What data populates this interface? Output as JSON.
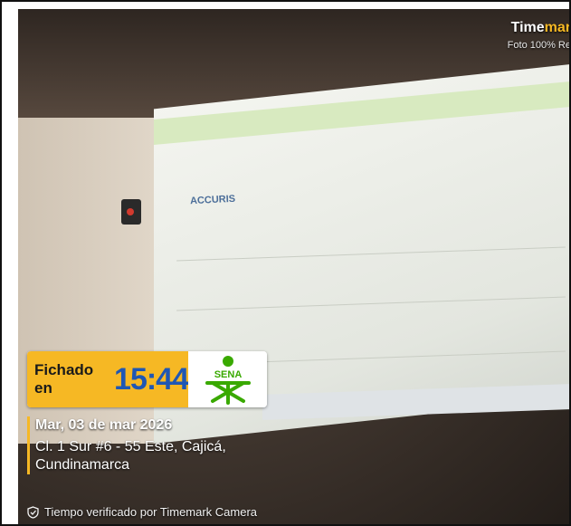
{
  "watermark": {
    "brand_part1": "Time",
    "brand_part2": "mar",
    "subtitle": "Foto 100% Re"
  },
  "stamp": {
    "label": "Fichado en",
    "time": "15:44",
    "logo_text": "SENA"
  },
  "info": {
    "date": "Mar, 03 de mar 2026",
    "address": "Cl. 1 Sur #6 - 55 Este, Cajicá, Cundinamarca"
  },
  "verified": {
    "text": "Tiempo verificado por Timemark Camera"
  },
  "screen": {
    "logo": "ACCURIS"
  },
  "colors": {
    "accent": "#f6b824",
    "time_blue": "#1f57b4",
    "sena_green": "#39a900"
  }
}
